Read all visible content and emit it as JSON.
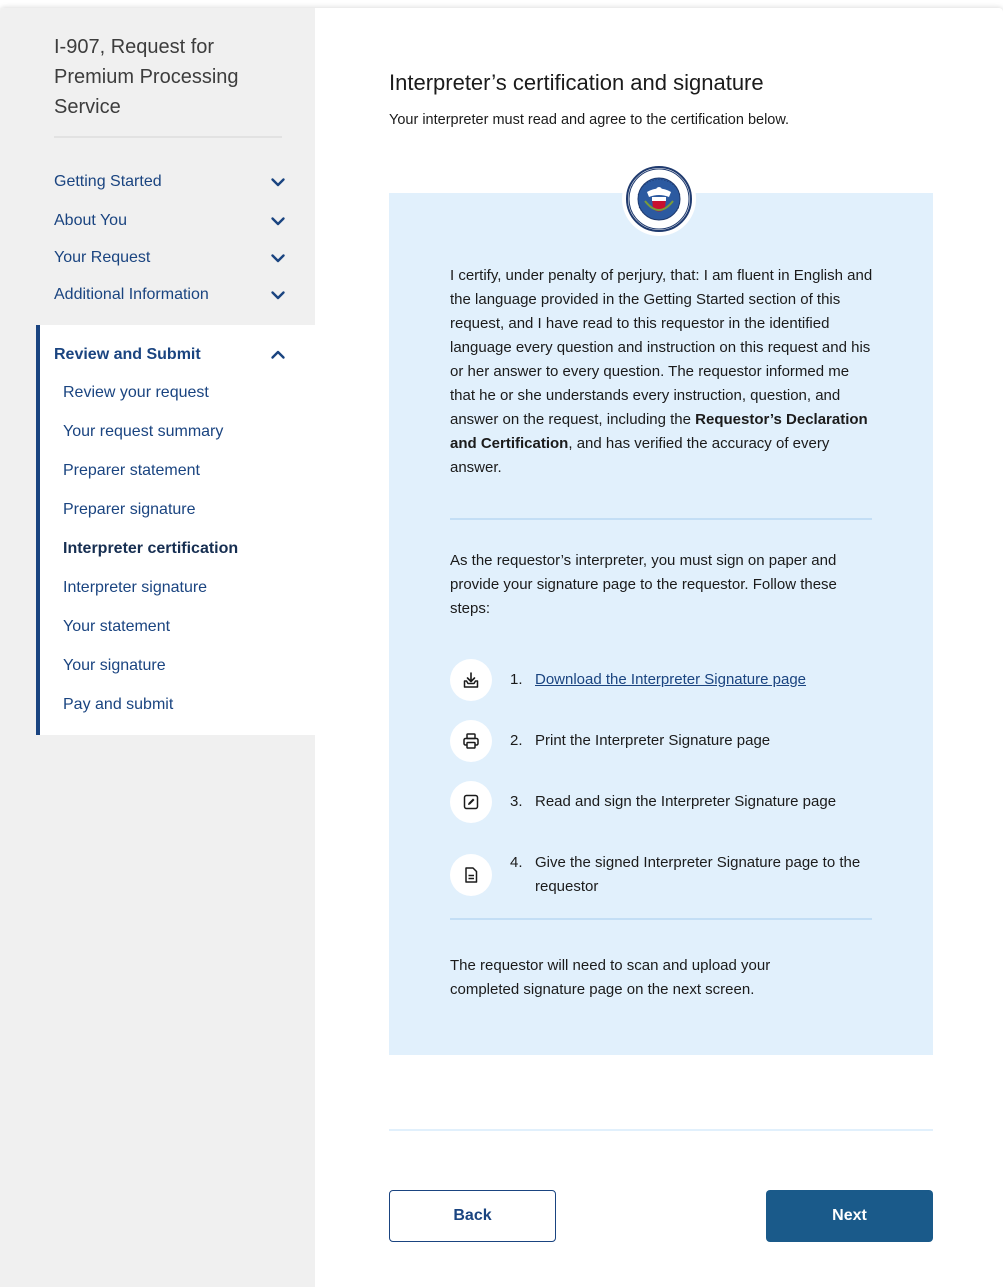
{
  "sidebar": {
    "title": "I-907, Request for Premium Processing Service",
    "sections": [
      {
        "label": "Getting Started"
      },
      {
        "label": "About You"
      },
      {
        "label": "Your Request"
      },
      {
        "label": "Additional Information"
      }
    ],
    "active_section": {
      "label": "Review and Submit",
      "items": [
        {
          "label": "Review your request"
        },
        {
          "label": "Your request summary"
        },
        {
          "label": "Preparer statement"
        },
        {
          "label": "Preparer signature"
        },
        {
          "label": "Interpreter certification"
        },
        {
          "label": "Interpreter signature"
        },
        {
          "label": "Your statement"
        },
        {
          "label": "Your signature"
        },
        {
          "label": "Pay and submit"
        }
      ],
      "current_item": "Interpreter certification"
    }
  },
  "main": {
    "title": "Interpreter’s certification and signature",
    "subtitle": "Your interpreter must read and agree to the certification below.",
    "seal_icon": "dhs-seal-icon",
    "certification": {
      "before_bold": "I certify, under penalty of perjury, that: I am fluent in English and the language provided in the Getting Started section of this request, and I have read to this requestor in the identified language every question and instruction on this request and his or her answer to every question. The requestor informed me that he or she understands every instruction, question, and answer on the request, including the ",
      "bold": "Requestor’s Declaration and Certification",
      "after_bold": ", and has verified the accuracy of every answer."
    },
    "instructions": "As the requestor’s interpreter, you must sign on paper and provide your signature page to the requestor. Follow these steps:",
    "steps": [
      {
        "num": "1.",
        "text": "Download the Interpreter Signature page",
        "icon": "download-icon",
        "is_link": true
      },
      {
        "num": "2.",
        "text": "Print the Interpreter Signature page",
        "icon": "print-icon",
        "is_link": false
      },
      {
        "num": "3.",
        "text": "Read and sign the Interpreter Signature page",
        "icon": "edit-icon",
        "is_link": false
      },
      {
        "num": "4.",
        "text": "Give the signed Interpreter Signature page to the requestor",
        "icon": "document-icon",
        "is_link": false
      }
    ],
    "final_note": "The requestor will need to scan and upload your completed signature page on the next screen."
  },
  "buttons": {
    "back_label": "Back",
    "next_label": "Next"
  },
  "colors": {
    "accent": "#1a4480",
    "panel": "#e1f0fc",
    "next_button": "#1a5a8a",
    "sidebar_bg": "#f0f0f0"
  }
}
